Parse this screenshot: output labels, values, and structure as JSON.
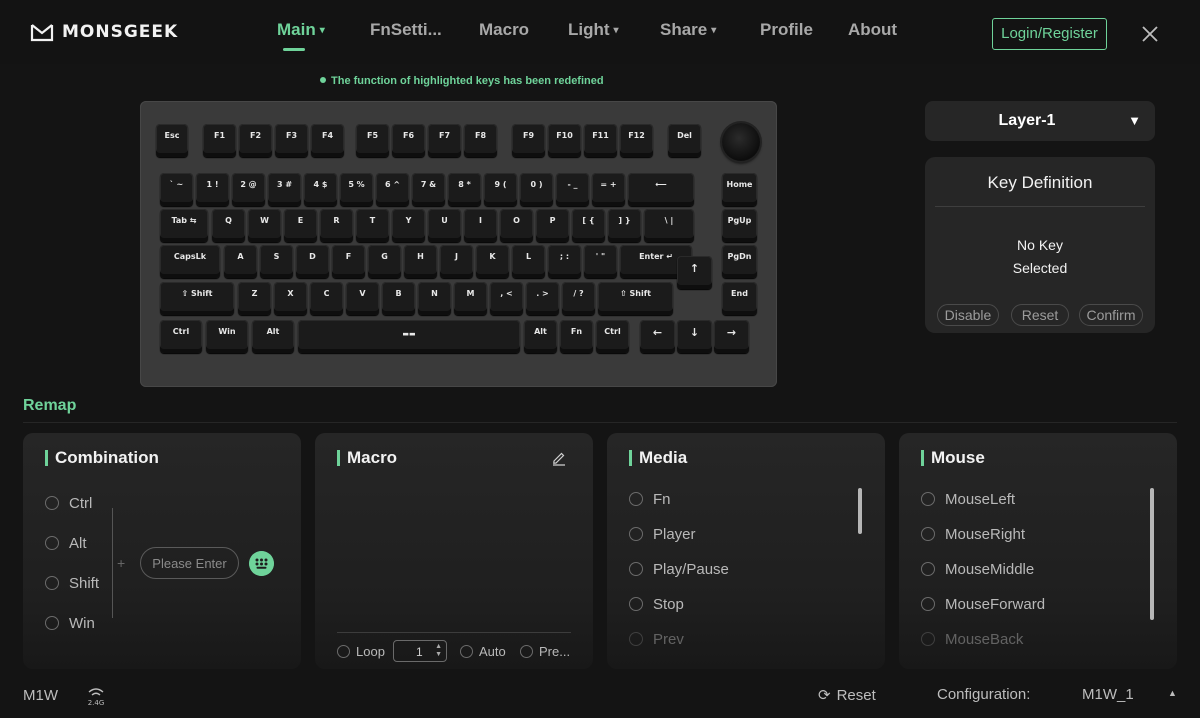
{
  "app": {
    "logo_text": "MONSGEEK"
  },
  "nav": {
    "items": [
      {
        "label": "Main",
        "caret": "▾",
        "active": true
      },
      {
        "label": "FnSetti...",
        "caret": "",
        "active": false
      },
      {
        "label": "Macro",
        "caret": "",
        "active": false
      },
      {
        "label": "Light",
        "caret": "▾",
        "active": false
      },
      {
        "label": "Share",
        "caret": "▾",
        "active": false
      },
      {
        "label": "Profile",
        "caret": "",
        "active": false
      },
      {
        "label": "About",
        "caret": "",
        "active": false
      }
    ],
    "login_label": "Login/Register",
    "accent": "#6fd39a"
  },
  "notice": {
    "text": "The function of highlighted keys has been redefined"
  },
  "keyboard": {
    "rows": [
      [
        "Esc",
        "F1",
        "F2",
        "F3",
        "F4",
        "F5",
        "F6",
        "F7",
        "F8",
        "F9",
        "F10",
        "F11",
        "F12",
        "Del"
      ],
      [
        "` ~",
        "1 !",
        "2 @",
        "3 #",
        "4 $",
        "5 %",
        "6 ^",
        "7 &",
        "8 *",
        "9 (",
        "0 )",
        "- _",
        "= +",
        "⟵",
        "Home"
      ],
      [
        "Tab ⇆",
        "Q",
        "W",
        "E",
        "R",
        "T",
        "Y",
        "U",
        "I",
        "O",
        "P",
        "[ {",
        "] }",
        "\\ |",
        "PgUp"
      ],
      [
        "CapsLk",
        "A",
        "S",
        "D",
        "F",
        "G",
        "H",
        "J",
        "K",
        "L",
        "; :",
        "' \"",
        "Enter ↵",
        "PgDn"
      ],
      [
        "⇧ Shift",
        "Z",
        "X",
        "C",
        "V",
        "B",
        "N",
        "M",
        ", <",
        ". >",
        "/ ?",
        "⇧ Shift",
        "↑",
        "End"
      ],
      [
        "Ctrl",
        "Win",
        "Alt",
        "▬▬",
        "Alt",
        "Fn",
        "Ctrl",
        "←",
        "↓",
        "→"
      ]
    ]
  },
  "layer": {
    "selected": "Layer-1",
    "arrow": "▼"
  },
  "key_definition": {
    "title": "Key Definition",
    "message_line1": "No Key",
    "message_line2": "Selected",
    "disable_label": "Disable",
    "reset_label": "Reset",
    "confirm_label": "Confirm"
  },
  "remap": {
    "title": "Remap",
    "combination": {
      "title": "Combination",
      "modifiers": [
        "Ctrl",
        "Alt",
        "Shift",
        "Win"
      ],
      "plus": "+",
      "input_placeholder": "Please Enter"
    },
    "macro": {
      "title": "Macro",
      "loop_label": "Loop",
      "loop_value": "1",
      "auto_label": "Auto",
      "pre_label": "Pre..."
    },
    "media": {
      "title": "Media",
      "items": [
        "Fn",
        "Player",
        "Play/Pause",
        "Stop",
        "Prev"
      ]
    },
    "mouse": {
      "title": "Mouse",
      "items": [
        "MouseLeft",
        "MouseRight",
        "MouseMiddle",
        "MouseForward",
        "MouseBack"
      ]
    }
  },
  "footer": {
    "model": "M1W",
    "wireless": "2.4G",
    "reset_label": "Reset",
    "config_label": "Configuration:",
    "config_value": "M1W_1",
    "caret": "▲"
  }
}
